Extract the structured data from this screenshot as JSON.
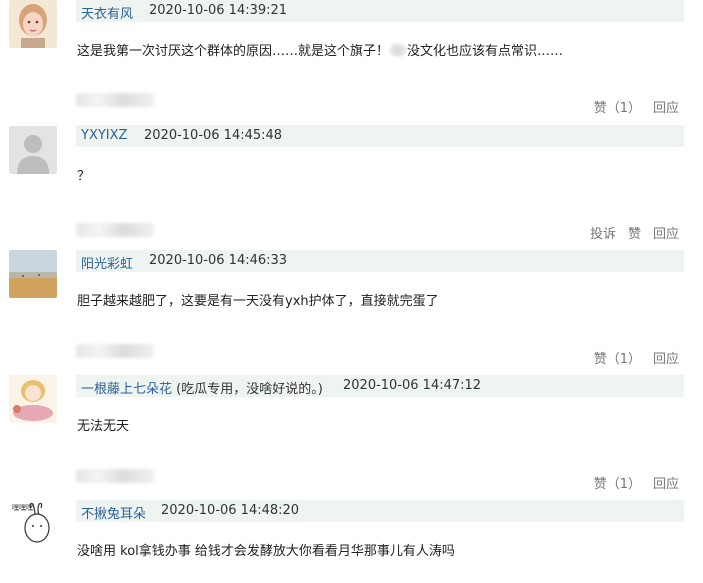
{
  "comments": [
    {
      "name": "天衣有风",
      "note": "",
      "time": "2020-10-06 14:39:21",
      "text_before": "这是我第一次讨厌这个群体的原因……就是这个旗子！",
      "text_after": "没文化也应该有点常识……",
      "actions": [
        "赞（1）",
        "回应"
      ]
    },
    {
      "name": "YXYIXZ",
      "note": "",
      "time": "2020-10-06 14:45:48",
      "text": "？",
      "actions": [
        "投诉",
        "赞",
        "回应"
      ]
    },
    {
      "name": "阳光彩虹",
      "note": "",
      "time": "2020-10-06 14:46:33",
      "text": "胆子越来越肥了，这要是有一天没有yxh护体了，直接就完蛋了",
      "actions": [
        "赞（1）",
        "回应"
      ]
    },
    {
      "name": "一根藤上七朵花",
      "note": "(吃瓜专用，没啥好说的。)",
      "time": "2020-10-06 14:47:12",
      "text": "无法无天",
      "actions": [
        "赞（1）",
        "回应"
      ]
    },
    {
      "name": "不揪兔耳朵",
      "note": "",
      "time": "2020-10-06 14:48:20",
      "text": "没啥用 kol拿钱办事 给钱才会发酵放大你看看月华那事儿有人涛吗"
    }
  ],
  "avatar_icons": [
    "illustrated-girl-avatar",
    "default-user-avatar",
    "beach-photo-avatar",
    "anime-girl-avatar",
    "bunny-doodle-avatar"
  ],
  "avatar_doodle_text": "嘿嘿嘿",
  "colors": {
    "header_bg": "#eef4ef",
    "name_link": "#2d5f9a",
    "action": "#777777"
  }
}
